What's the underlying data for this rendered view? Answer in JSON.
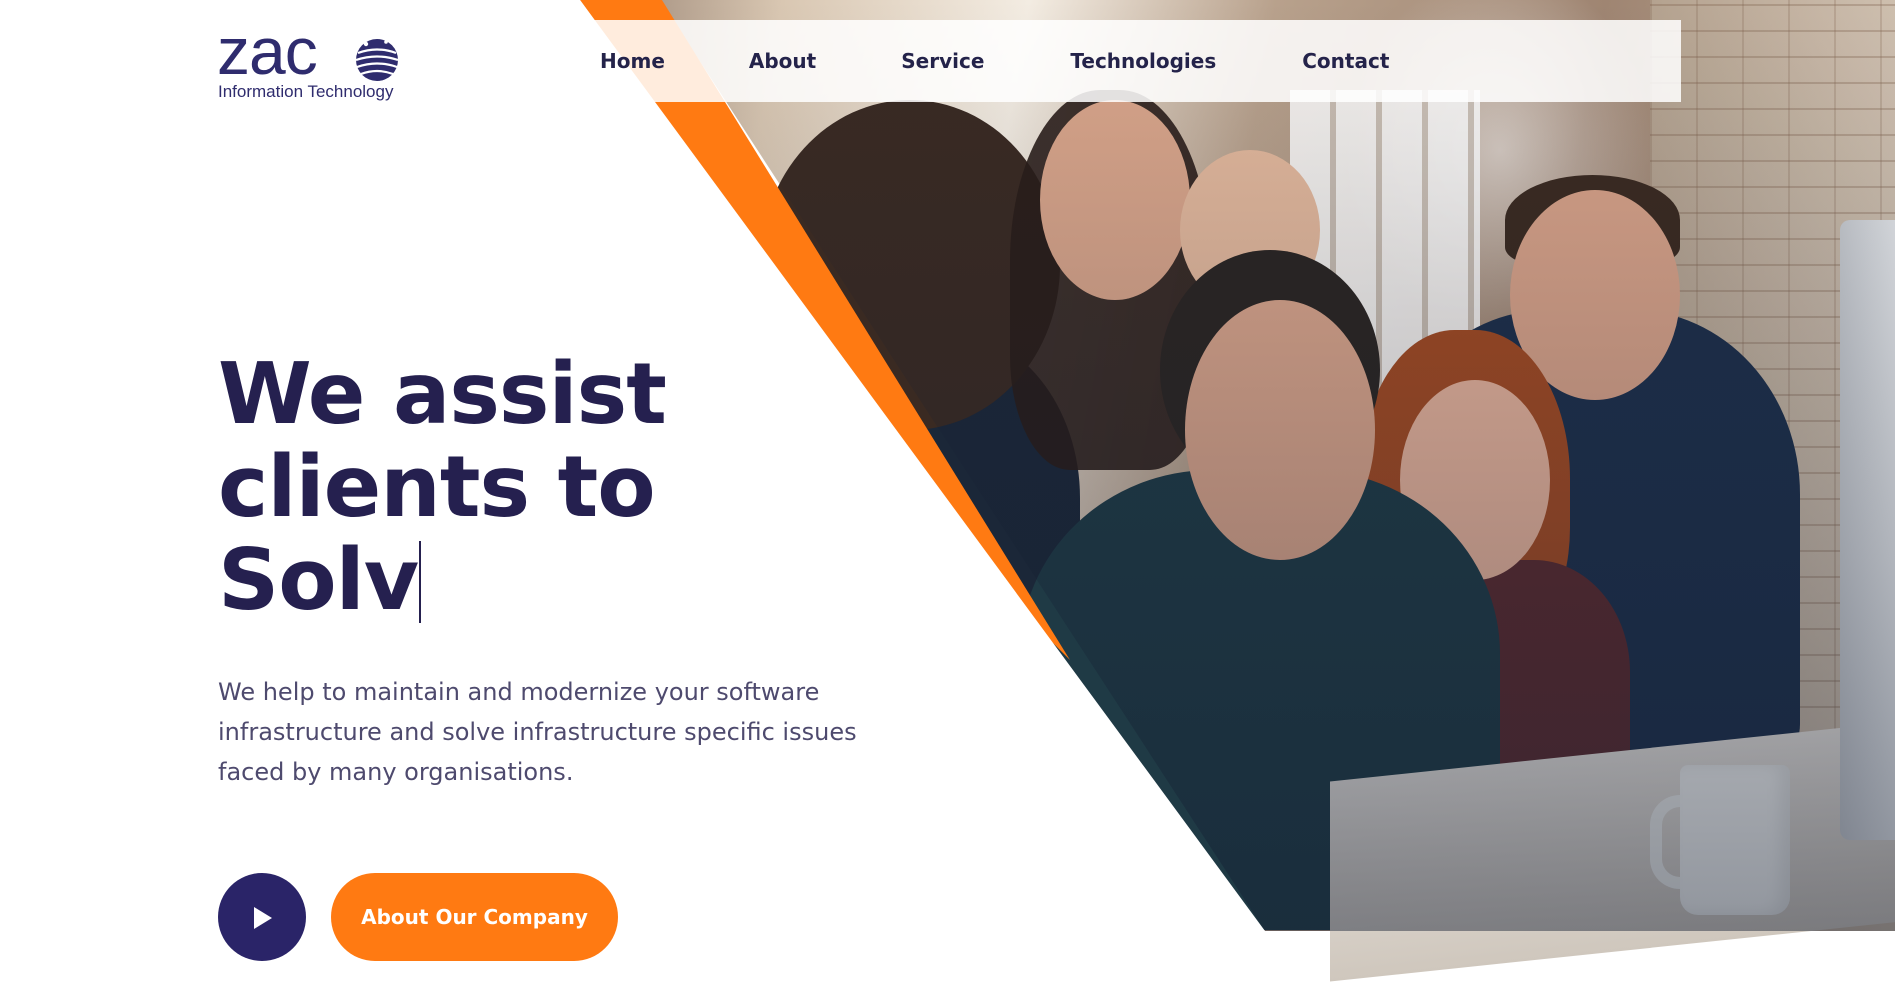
{
  "logo": {
    "wordmark": "zac",
    "subtitle": "Information Technology"
  },
  "nav": {
    "items": [
      {
        "label": "Home"
      },
      {
        "label": "About"
      },
      {
        "label": "Service"
      },
      {
        "label": "Technologies"
      },
      {
        "label": "Contact"
      }
    ]
  },
  "hero": {
    "headline_line1": "We assist",
    "headline_line2": "clients to",
    "headline_line3": "Solv",
    "description": "We help to maintain and modernize your software infrastructure and solve infrastructure specific issues faced by many organisations.",
    "cta_label": "About Our Company",
    "play_icon": "play-icon"
  },
  "colors": {
    "brand_navy": "#25204f",
    "accent_orange": "#ff7a12",
    "text_muted": "#4e4a6e"
  }
}
